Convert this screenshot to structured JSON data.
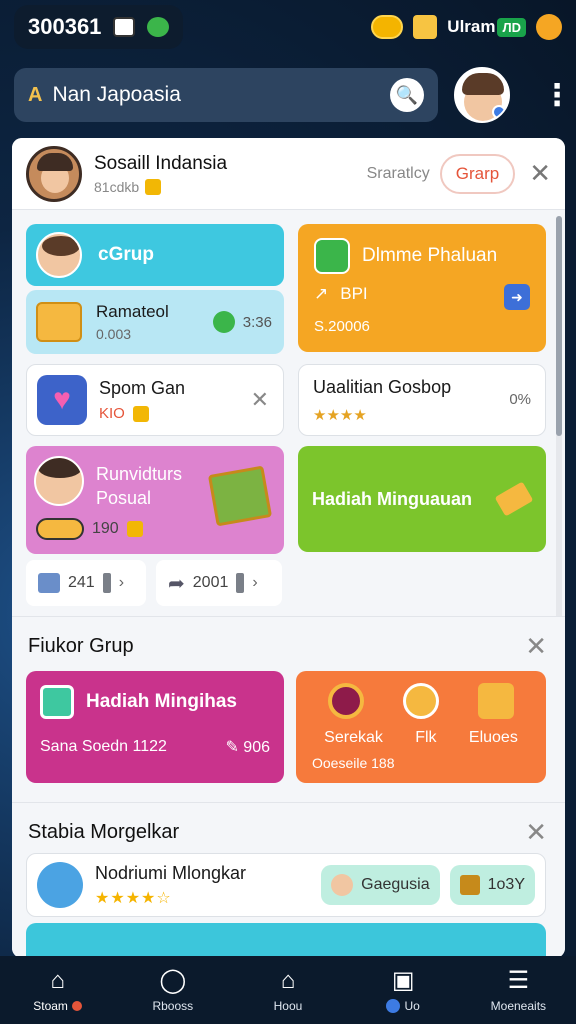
{
  "status": {
    "time": "300361",
    "label": "Ulram",
    "badge": "ЛD"
  },
  "search": {
    "lead": "A",
    "text": "Nan Japoasia"
  },
  "panel": {
    "title": "Sosaill Indansia",
    "subtitle": "81cdkb",
    "stat": "Sraratlcy",
    "button": "Grarp"
  },
  "cards": {
    "c1": "cGrup",
    "c1b_title": "Ramateol",
    "c1b_sub": "0.003",
    "c1b_right": "3:36",
    "c2_title": "Dlmme Phaluan",
    "c2_mid": "BPI",
    "c2_bot": "S.20006",
    "c3_title": "Spom Gan",
    "c3_sub": "KIO",
    "c4_title": "Uaalitian Gosbop",
    "c4_pct": "0%",
    "c5_title": "Runvidturs Posual",
    "c5_sub": "190",
    "c6_title": "Hadiah Minguauan",
    "m1": "241",
    "m2": "2001"
  },
  "section1": {
    "title": "Fiukor Grup",
    "pink_title": "Hadiah Mingihas",
    "pink_bot": "Sana Soedn 1122",
    "pink_val": "906",
    "orange_labels": [
      "Serekak",
      "Flk",
      "Eluoes"
    ],
    "orange_bot": "Ooeseile 188"
  },
  "section2": {
    "title": "Stabia Morgelkar",
    "row_title": "Nodriumi Mlongkar",
    "stars": "★★★★☆",
    "chip1": "Gaegusia",
    "chip2": "1o3Y"
  },
  "nav": [
    {
      "label": "Stoam"
    },
    {
      "label": "Rbooss"
    },
    {
      "label": "Hoou"
    },
    {
      "label": "Uo"
    },
    {
      "label": "Moeneaits"
    }
  ],
  "colors": {
    "accent": "#e5553a",
    "cyan": "#3ec8e0",
    "orange": "#f5a623",
    "pink": "#c9338c",
    "green": "#7cc52c"
  }
}
